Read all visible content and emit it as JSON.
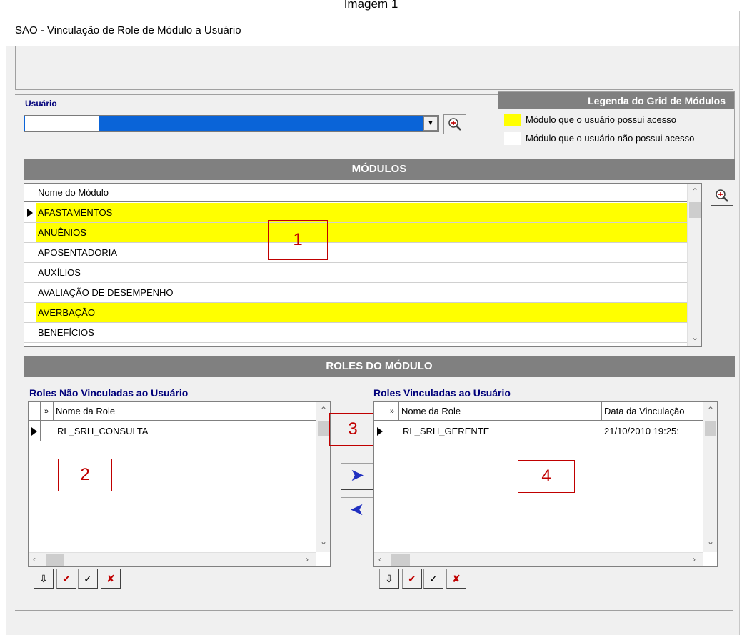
{
  "caption": "Imagem 1",
  "window": {
    "title": "SAO - Vinculação de Role de Módulo a Usuário"
  },
  "usuario": {
    "label": "Usuário",
    "value": ""
  },
  "legend": {
    "title": "Legenda do Grid de Módulos",
    "items": [
      {
        "color": "#ffff00",
        "text": "Módulo que o usuário possui acesso"
      },
      {
        "color": "#ffffff",
        "text": "Módulo que o usuário não possui acesso"
      }
    ]
  },
  "modulos": {
    "title": "MÓDULOS",
    "column": "Nome do Módulo",
    "rows": [
      {
        "name": "AFASTAMENTOS",
        "access": true,
        "current": true
      },
      {
        "name": "ANUÊNIOS",
        "access": true,
        "current": false
      },
      {
        "name": "APOSENTADORIA",
        "access": false,
        "current": false
      },
      {
        "name": "AUXÍLIOS",
        "access": false,
        "current": false
      },
      {
        "name": "AVALIAÇÃO DE DESEMPENHO",
        "access": false,
        "current": false
      },
      {
        "name": "AVERBAÇÃO",
        "access": true,
        "current": false
      },
      {
        "name": "BENEFÍCIOS",
        "access": false,
        "current": false
      }
    ]
  },
  "roles": {
    "title": "ROLES DO MÓDULO",
    "nao_vinculadas": {
      "label": "Roles Não Vinculadas ao Usuário",
      "col_sel": "»",
      "col_name": "Nome da Role",
      "rows": [
        {
          "name": "RL_SRH_CONSULTA"
        }
      ]
    },
    "vinculadas": {
      "label": "Roles Vinculadas ao Usuário",
      "col_sel": "»",
      "col_name": "Nome da Role",
      "col_date": "Data da Vinculação",
      "rows": [
        {
          "name": "RL_SRH_GERENTE",
          "date": "21/10/2010 19:25:"
        }
      ]
    }
  },
  "annotations": [
    "1",
    "2",
    "3",
    "4"
  ],
  "icons": {
    "search": "magnifier-plus-icon",
    "move_right": "arrow-right-icon",
    "move_left": "arrow-left-icon"
  }
}
